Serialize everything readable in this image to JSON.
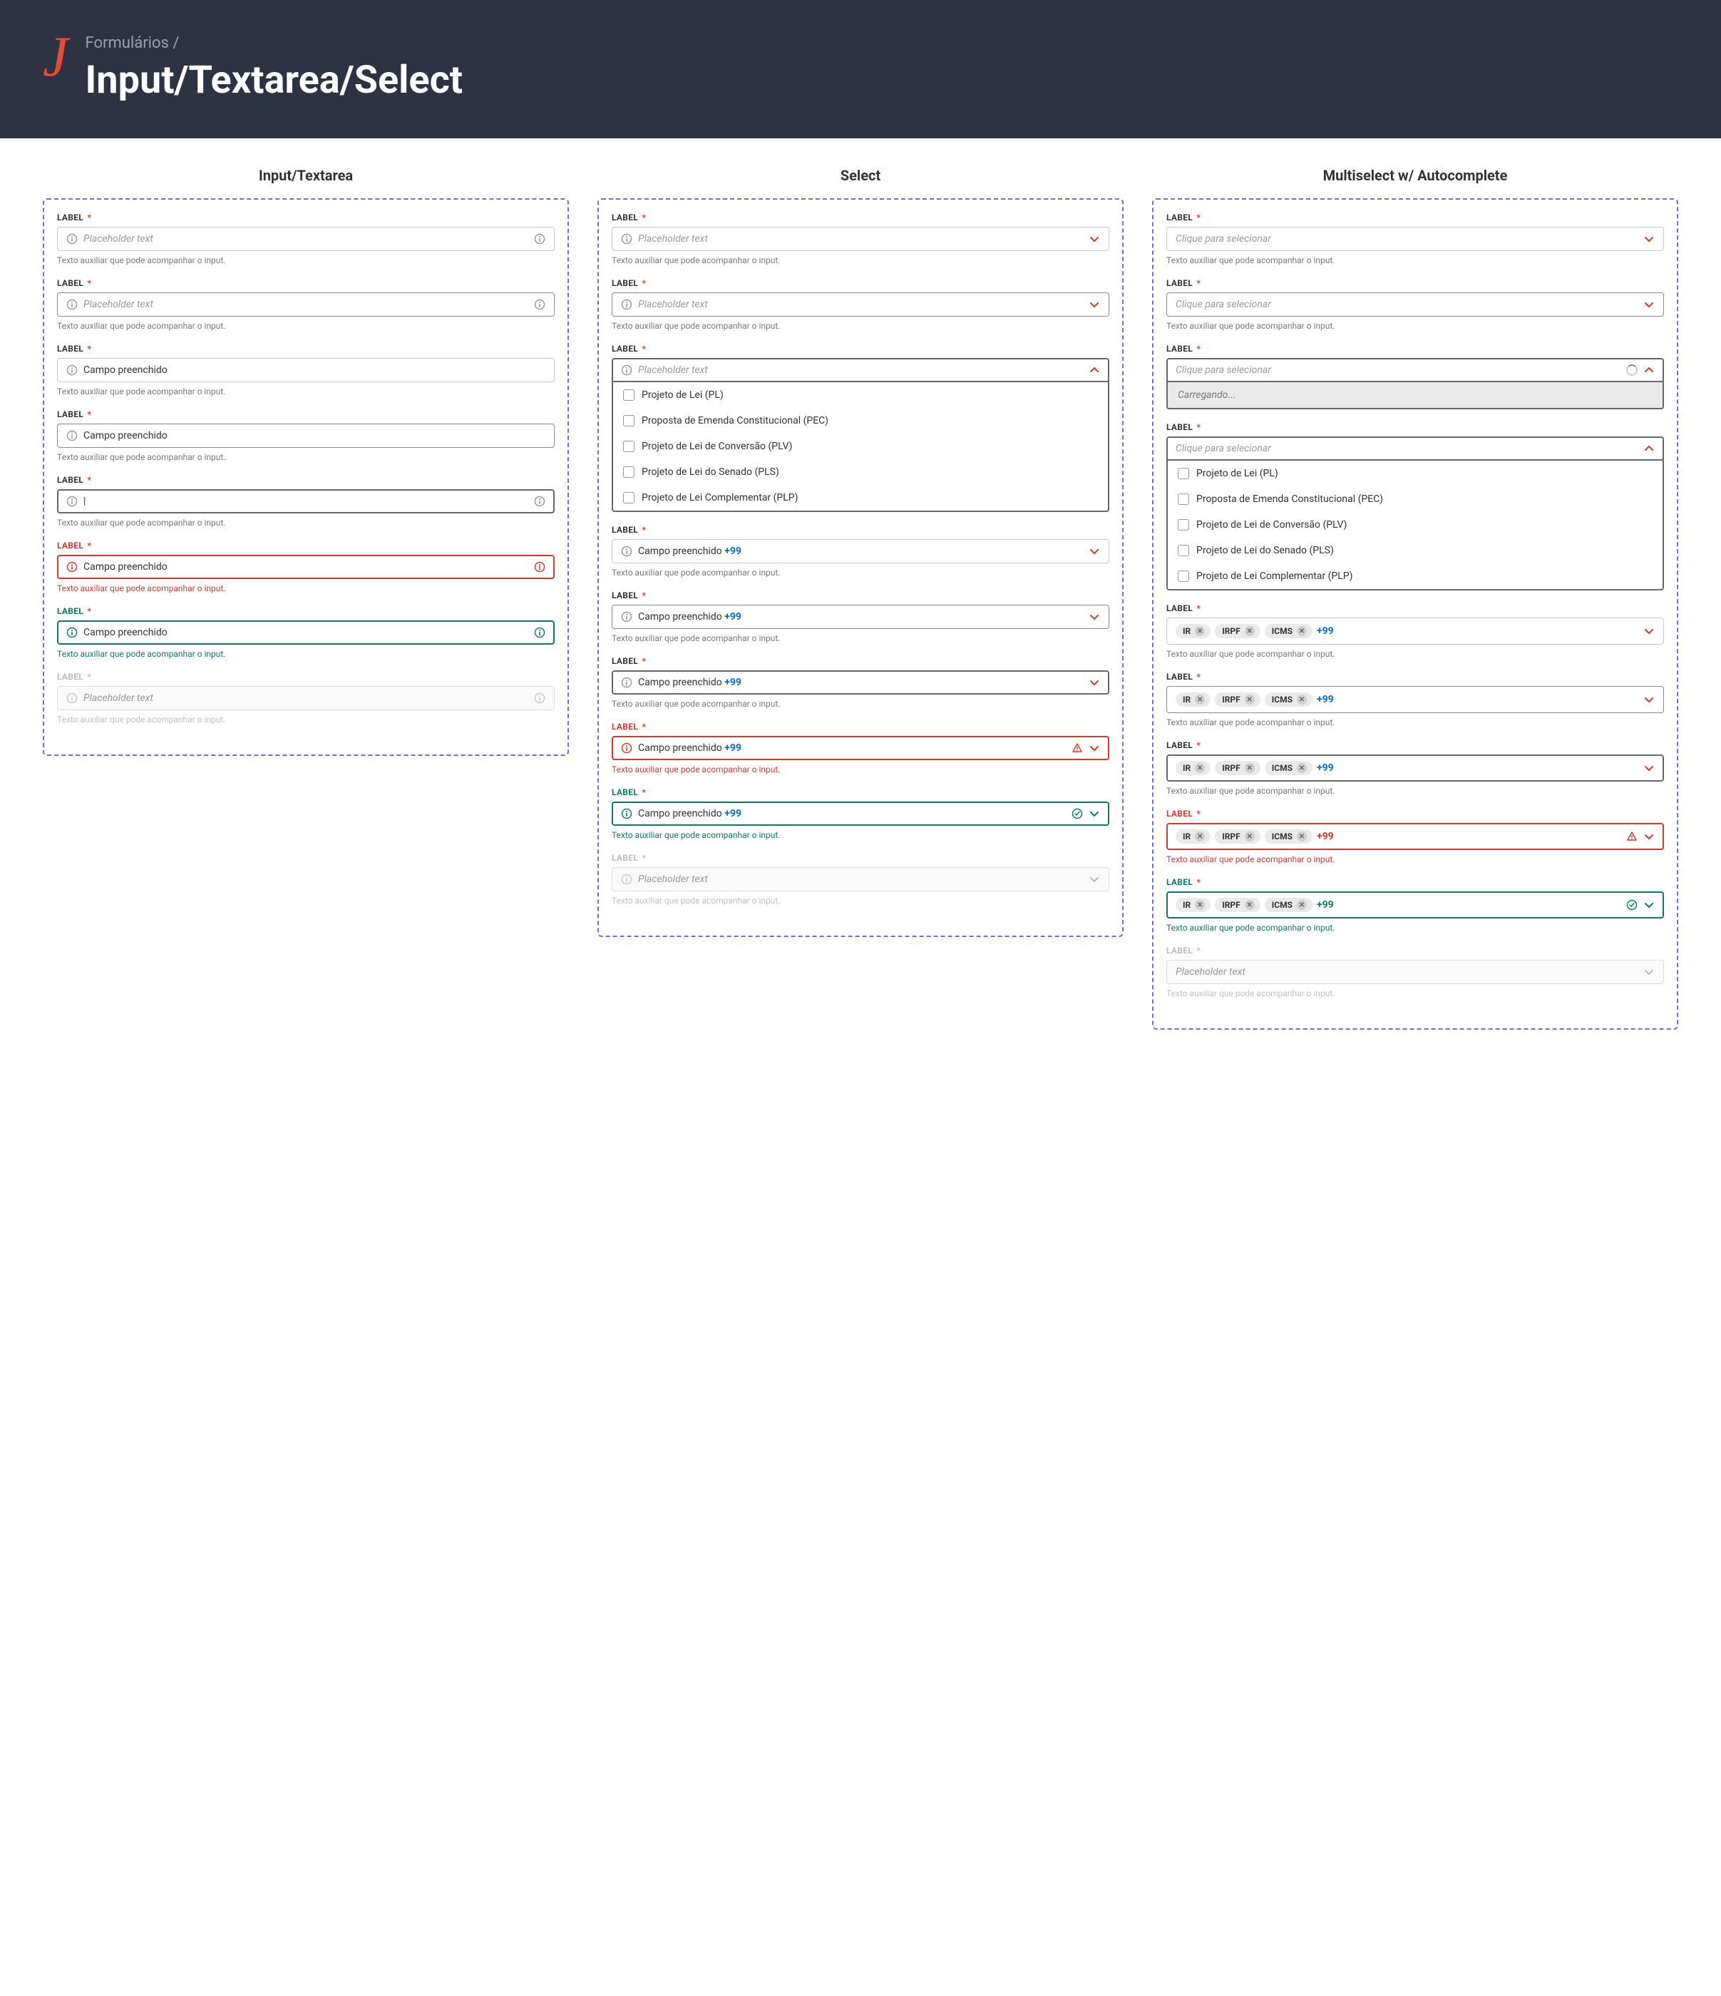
{
  "header": {
    "breadcrumb": "Formulários /",
    "title": "Input/Textarea/Select"
  },
  "columns": {
    "input": {
      "title": "Input/Textarea"
    },
    "select": {
      "title": "Select"
    },
    "multi": {
      "title": "Multiselect w/ Autocomplete"
    }
  },
  "common": {
    "label": "LABEL",
    "required_marker": "*",
    "helper": "Texto auxiliar que pode acompanhar o input.",
    "placeholder": "Placeholder text",
    "click_placeholder": "Clique para selecionar",
    "filled_value": "Campo preenchido",
    "caret": "|",
    "count_badge": "+99",
    "loading": "Carregando..."
  },
  "options": [
    "Projeto de Lei (PL)",
    "Proposta de Emenda Constitucional (PEC)",
    "Projeto de Lei de Conversão (PLV)",
    "Projeto de Lei do Senado (PLS)",
    "Projeto de Lei Complementar (PLP)"
  ],
  "chips": [
    "IR",
    "IRPF",
    "ICMS"
  ]
}
